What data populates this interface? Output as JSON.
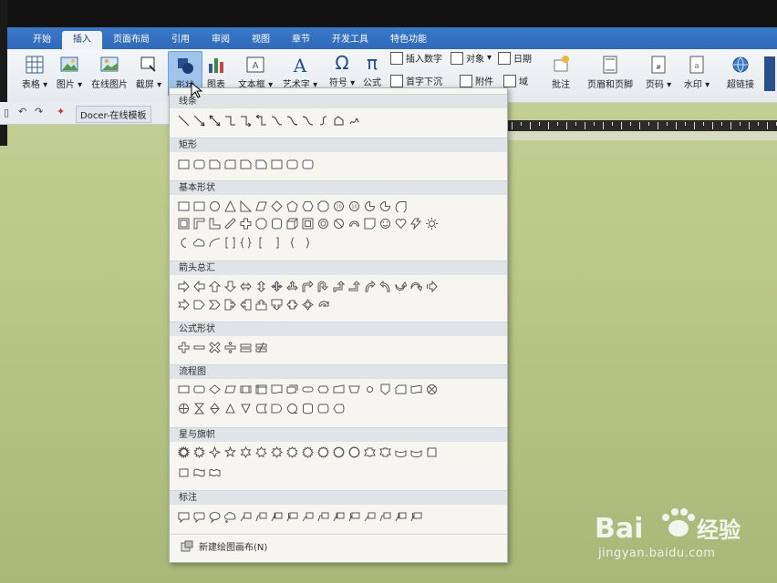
{
  "tabs": [
    {
      "label": "开始"
    },
    {
      "label": "插入",
      "active": true
    },
    {
      "label": "页面布局"
    },
    {
      "label": "引用"
    },
    {
      "label": "审阅"
    },
    {
      "label": "视图"
    },
    {
      "label": "章节"
    },
    {
      "label": "开发工具"
    },
    {
      "label": "特色功能"
    }
  ],
  "ribbon": {
    "table": "表格",
    "picture": "图片",
    "online_picture": "在线图片",
    "screenshot": "截屏",
    "shapes": "形状",
    "chart": "图表",
    "textbox": "文本框",
    "wordart": "艺术字",
    "symbol": "符号",
    "formula": "公式",
    "insert_number": "插入数字",
    "object": "对象",
    "date": "日期",
    "drop_cap": "首字下沉",
    "attachment": "附件",
    "field": "域",
    "comment": "批注",
    "header_footer": "页眉和页脚",
    "page_number": "页码",
    "watermark": "水印",
    "hyperlink": "超链接"
  },
  "quickbar": {
    "docer": "Docer-在线模板"
  },
  "shapes_menu": {
    "categories": [
      "线条",
      "矩形",
      "基本形状",
      "箭头总汇",
      "公式形状",
      "流程图",
      "星与旗帜",
      "标注"
    ],
    "new_canvas": "新建绘图画布(N)"
  },
  "colors": {
    "accent": "#2f6ab8",
    "selected": "#9fc4ec",
    "panel": "#f7f5ef"
  },
  "watermark": {
    "brand": "Baidu经验",
    "site": "jingyan.baidu.com"
  }
}
